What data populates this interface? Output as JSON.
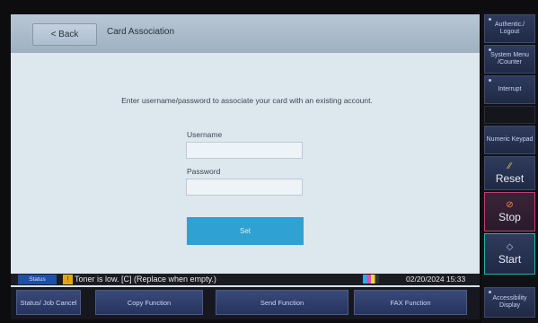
{
  "header": {
    "back_label": "< Back",
    "title": "Card Association"
  },
  "form": {
    "instructions": "Enter username/password to associate your card with an existing account.",
    "username_label": "Username",
    "username_value": "",
    "password_label": "Password",
    "password_value": "",
    "set_label": "Set"
  },
  "status_bar": {
    "tag": "Status",
    "message": "Toner is low. [C] (Replace when empty.)",
    "datetime": "02/20/2024  15:33"
  },
  "bottom_nav": [
    {
      "label": "Status/ Job Cancel"
    },
    {
      "label": "Copy Function"
    },
    {
      "label": "Send Function"
    },
    {
      "label": "FAX Function"
    },
    {
      "label": "Accessibility Display"
    }
  ],
  "side_keys": {
    "auth": "Authentic./ Logout",
    "system_menu": "System Menu /Counter",
    "interrupt": "Interrupt",
    "numeric_keypad": "Numeric Keypad",
    "reset": "Reset",
    "stop": "Stop",
    "start": "Start"
  },
  "colors": {
    "set_button": "#2fa1d2",
    "status_tag": "#1d4fa8",
    "toner_warning": "#e1a51a"
  }
}
